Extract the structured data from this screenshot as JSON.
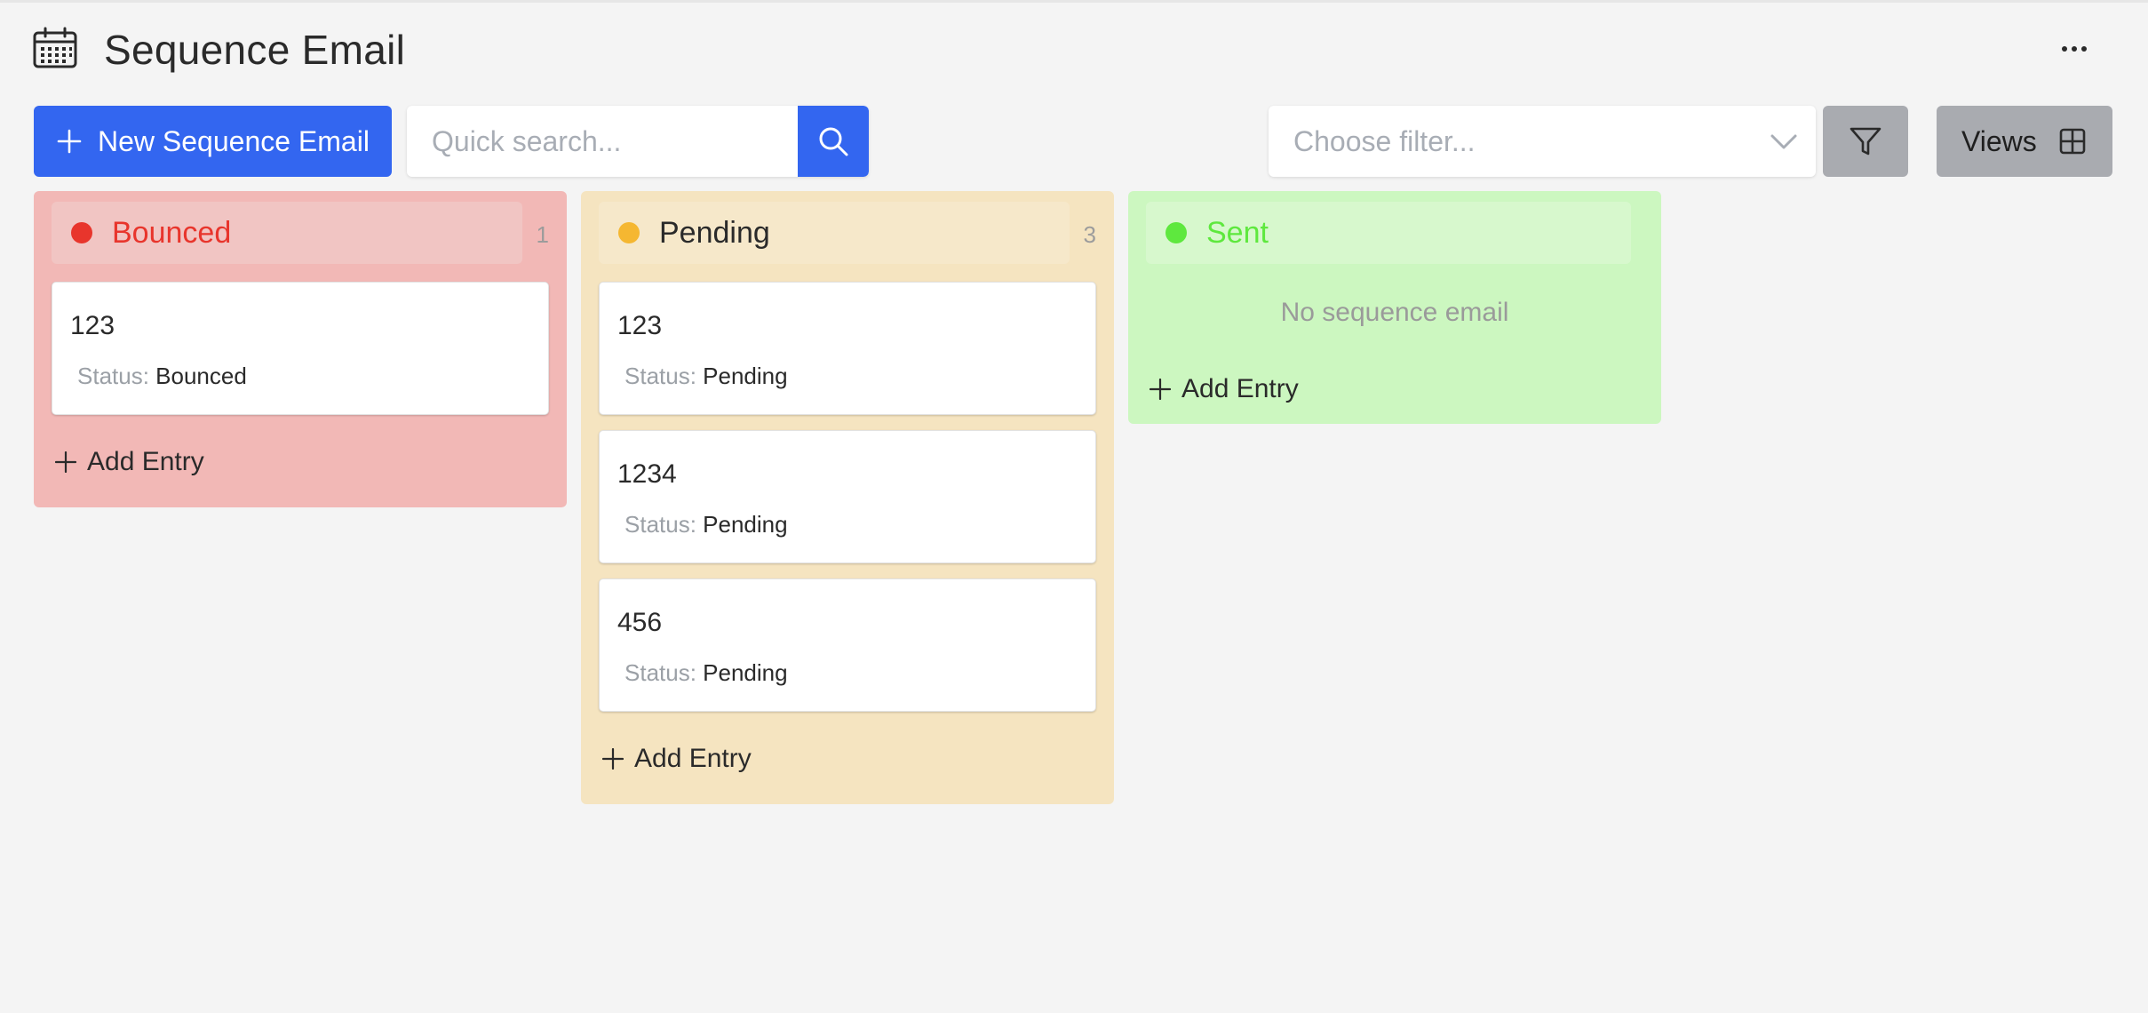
{
  "header": {
    "title": "Sequence Email",
    "icon": "calendar-icon",
    "more_icon": "ellipsis-icon"
  },
  "toolbar": {
    "new_label": "New Sequence Email",
    "search_placeholder": "Quick search...",
    "filter_placeholder": "Choose filter...",
    "views_label": "Views"
  },
  "colors": {
    "primary": "#3366f0",
    "bounced": "#e8352c",
    "pending": "#f5b731",
    "sent": "#5ee83e"
  },
  "columns": {
    "bounced": {
      "title": "Bounced",
      "count": "1",
      "cards": [
        {
          "title": "123",
          "status_label": "Status:",
          "status": "Bounced"
        }
      ],
      "add_label": "Add Entry"
    },
    "pending": {
      "title": "Pending",
      "count": "3",
      "cards": [
        {
          "title": "123",
          "status_label": "Status:",
          "status": "Pending"
        },
        {
          "title": "1234",
          "status_label": "Status:",
          "status": "Pending"
        },
        {
          "title": "456",
          "status_label": "Status:",
          "status": "Pending"
        }
      ],
      "add_label": "Add Entry"
    },
    "sent": {
      "title": "Sent",
      "empty_text": "No sequence email",
      "add_label": "Add Entry"
    }
  }
}
